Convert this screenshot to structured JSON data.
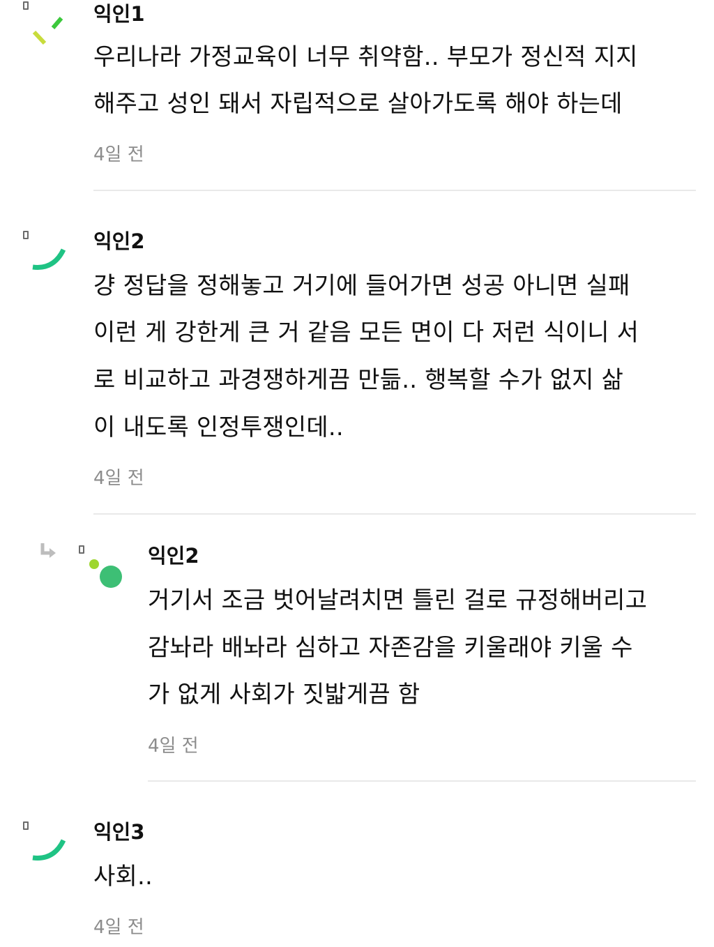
{
  "comments": [
    {
      "author": "익인1",
      "lines": [
        "우리나라 가정교육이 너무 취약함.. 부모가 정신적 지지",
        "해주고 성인 돼서 자립적으로 살아가도록 해야 하는데"
      ],
      "time": "4일 전",
      "avatar_icon": "lime-green-dashes-avatar-icon",
      "colors": [
        "#c8dc3c",
        "#3cc83c"
      ]
    },
    {
      "author": "익인2",
      "lines": [
        "걍 정답을 정해놓고 거기에 들어가면 성공 아니면 실패",
        "이런 게 강한게 큰 거 같음 모든 면이 다 저런 식이니 서",
        "로 비교하고 과경쟁하게끔 만듦.. 행복할 수가 없지 삶",
        "이 내도록 인정투쟁인데.."
      ],
      "time": "4일 전",
      "avatar_icon": "green-arc-avatar-icon",
      "colors": [
        "#1fc384"
      ]
    },
    {
      "author": "익인2",
      "is_reply": true,
      "reply_icon": "reply-arrow-icon",
      "lines": [
        "거기서 조금 벗어날려치면 틀린 걸로 규정해버리고",
        "감놔라 배놔라 심하고 자존감을 키울래야 키울 수",
        "가 없게 사회가 짓밟게끔 함"
      ],
      "time": "4일 전",
      "avatar_icon": "green-dots-avatar-icon",
      "colors": [
        "#9ed62f",
        "#3dbf75"
      ]
    },
    {
      "author": "익인3",
      "lines": [
        "사회.."
      ],
      "time": "4일 전",
      "avatar_icon": "green-arc-avatar-icon",
      "colors": [
        "#1fc384"
      ]
    }
  ]
}
